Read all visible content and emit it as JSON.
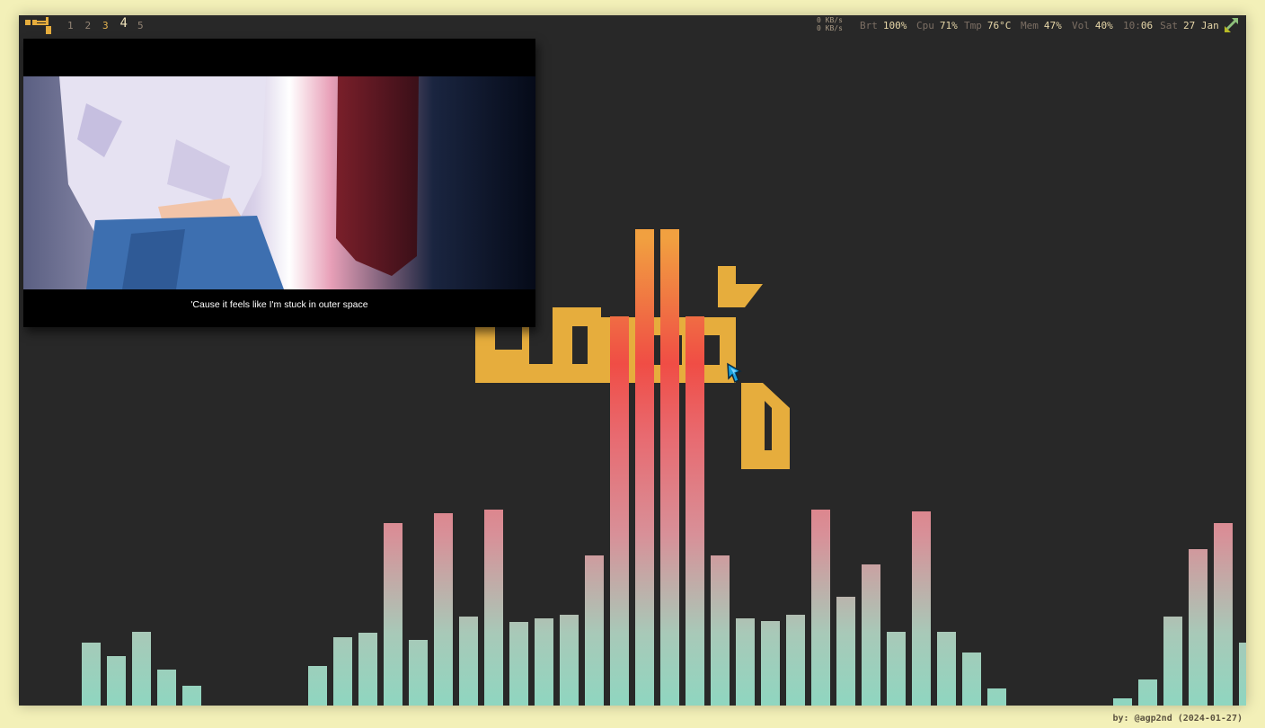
{
  "topbar": {
    "logo": "agp-logo-icon",
    "workspaces": [
      {
        "label": "1",
        "state": "empty"
      },
      {
        "label": "2",
        "state": "empty"
      },
      {
        "label": "3",
        "state": "occupied"
      },
      {
        "label": "4",
        "state": "active"
      },
      {
        "label": "5",
        "state": "empty"
      }
    ],
    "net": {
      "up": "0 KB/s",
      "down": "0 KB/s"
    },
    "stats": [
      {
        "key": "Brt",
        "value": "100%"
      },
      {
        "key": "Cpu",
        "value": "71%"
      },
      {
        "key": "Tmp",
        "value": "76°C"
      },
      {
        "key": "Mem",
        "value": "47%"
      },
      {
        "key": "Vol",
        "value": "40%"
      }
    ],
    "clock": {
      "time_a": "10:",
      "time_b": "06",
      "day": "Sat",
      "date": "27 Jan"
    },
    "tray_icon": "sync-arrows-icon"
  },
  "video_player": {
    "subtitle": "'Cause it feels like I'm stuck in outer space"
  },
  "visualizer": {
    "levels": [
      0,
      0.091,
      0.072,
      0.107,
      0.052,
      0.029,
      0,
      0,
      0,
      0,
      0.057,
      0.099,
      0.105,
      0.264,
      0.095,
      0.278,
      0.129,
      0.284,
      0.121,
      0.126,
      0.131,
      0.217,
      0.564,
      0.69,
      0.69,
      0.564,
      0.217,
      0.126,
      0.123,
      0.131,
      0.284,
      0.158,
      0.204,
      0.107,
      0.281,
      0.107,
      0.077,
      0.025,
      0,
      0,
      0,
      0,
      0.011,
      0.038,
      0.129,
      0.227,
      0.264,
      0.091,
      0.05
    ],
    "colors": {
      "bottom": "#8fd6c0",
      "middle": "#d89098",
      "peak": "#f04d45",
      "top": "#f1a040"
    }
  },
  "wallpaper": {
    "logo": "agp-logo-icon",
    "color": "#e6ad3d"
  },
  "background": "#282828",
  "credit": "by: @agp2nd (2024-01-27)"
}
